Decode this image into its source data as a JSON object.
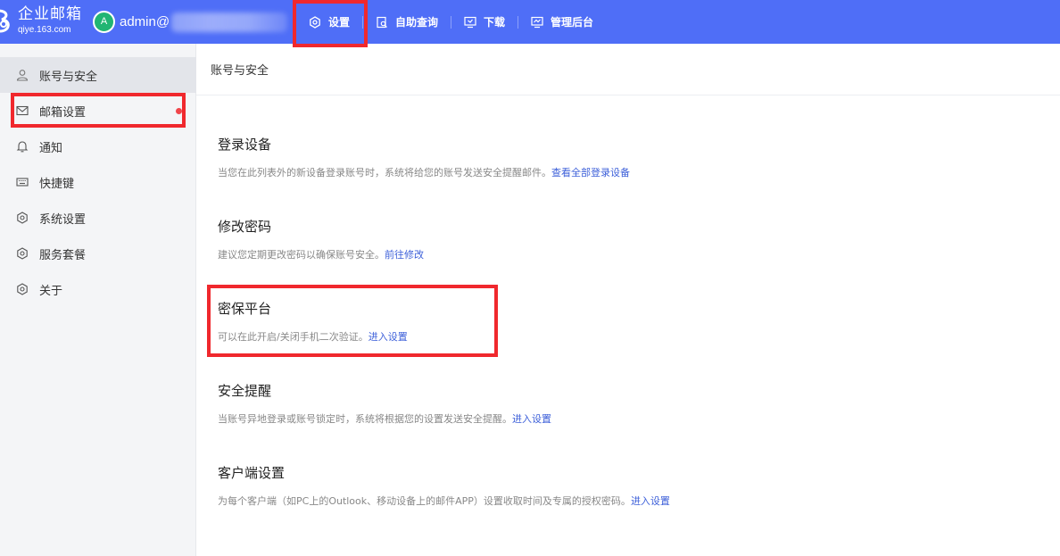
{
  "app": {
    "brand_title": "企业邮箱",
    "brand_sub": "qiye.163.com",
    "avatar_letter": "A",
    "username": "admin@"
  },
  "nav": {
    "items": [
      {
        "label": "设置",
        "icon": "settings-hex-icon"
      },
      {
        "label": "自助查询",
        "icon": "search-doc-icon"
      },
      {
        "label": "下载",
        "icon": "monitor-download-icon"
      },
      {
        "label": "管理后台",
        "icon": "monitor-admin-icon"
      }
    ]
  },
  "sidebar": {
    "items": [
      {
        "label": "账号与安全",
        "icon": "user-icon",
        "active": true
      },
      {
        "label": "邮箱设置",
        "icon": "mail-icon",
        "badge_dot": true
      },
      {
        "label": "通知",
        "icon": "bell-icon"
      },
      {
        "label": "快捷键",
        "icon": "keyboard-icon"
      },
      {
        "label": "系统设置",
        "icon": "settings-hex-icon"
      },
      {
        "label": "服务套餐",
        "icon": "settings-hex-icon"
      },
      {
        "label": "关于",
        "icon": "settings-hex-icon"
      }
    ]
  },
  "main": {
    "title": "账号与安全",
    "sections": [
      {
        "title": "登录设备",
        "desc": "当您在此列表外的新设备登录账号时，系统将给您的账号发送安全提醒邮件。",
        "link": "查看全部登录设备"
      },
      {
        "title": "修改密码",
        "desc": "建议您定期更改密码以确保账号安全。",
        "link": "前往修改"
      },
      {
        "title": "密保平台",
        "desc": "可以在此开启/关闭手机二次验证。",
        "link": "进入设置"
      },
      {
        "title": "安全提醒",
        "desc": "当账号异地登录或账号锁定时，系统将根据您的设置发送安全提醒。",
        "link": "进入设置"
      },
      {
        "title": "客户端设置",
        "desc": "为每个客户端（如PC上的Outlook、移动设备上的邮件APP）设置收取时间及专属的授权密码。",
        "link": "进入设置"
      }
    ]
  },
  "colors": {
    "topbar": "#4f6ef7",
    "link": "#3c5fd9",
    "highlight": "#f0282d",
    "avatar": "#21b573"
  }
}
